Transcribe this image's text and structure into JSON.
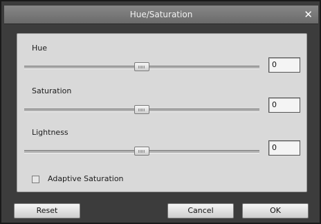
{
  "window": {
    "title": "Hue/Saturation",
    "close_icon": "close-icon"
  },
  "sliders": [
    {
      "label": "Hue",
      "value": "0",
      "position": 0.5
    },
    {
      "label": "Saturation",
      "value": "0",
      "position": 0.5
    },
    {
      "label": "Lightness",
      "value": "0",
      "position": 0.5
    }
  ],
  "checkbox": {
    "label": "Adaptive Saturation",
    "checked": false
  },
  "buttons": {
    "reset": "Reset",
    "cancel": "Cancel",
    "ok": "OK"
  }
}
